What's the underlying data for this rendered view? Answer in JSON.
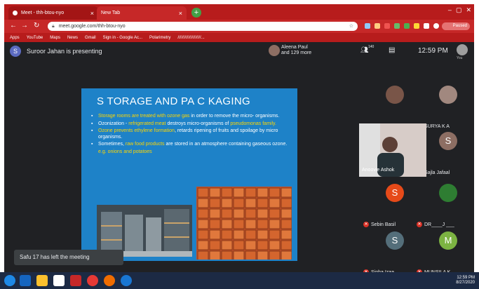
{
  "browser": {
    "tabs": [
      {
        "label": "Meet - thh-btou-nyo",
        "close": "×"
      },
      {
        "label": "New Tab",
        "close": "×"
      }
    ],
    "new_tab": "+",
    "window_controls": [
      "–",
      "▢",
      "✕"
    ],
    "url": "meet.google.com/thh-btou-nyo",
    "profile": "Paused",
    "bookmarks": [
      "Apps",
      "YouTube",
      "Maps",
      "News",
      "Gmail",
      "Sign in - Google Ac...",
      "Polarimetry",
      "////////////////////..."
    ]
  },
  "meet": {
    "presenter_initial": "S",
    "presenter_text": "Suroor Jahan is presenting",
    "people_line1": "Aleena Paul",
    "people_line2": "and 129 more",
    "participant_count": "140",
    "time": "12:59 PM",
    "you_label": "You",
    "toast": "Safu 17 has left the meeting"
  },
  "slide": {
    "title": "S TORAGE AND PA C KAGING",
    "bullets": [
      {
        "parts": [
          [
            "Storage rooms are treated with ",
            "y"
          ],
          [
            "ozone gas",
            "y"
          ],
          [
            " in order to remove the micro- organisms.",
            ""
          ]
        ]
      },
      {
        "parts": [
          [
            "Ozonization - ",
            ""
          ],
          [
            "refrigerated meat",
            "y"
          ],
          [
            " destroys micro-organisms of ",
            ""
          ],
          [
            "pseudomonas family.",
            "y"
          ]
        ]
      },
      {
        "parts": [
          [
            "Ozone prevents ethylene formation",
            "y"
          ],
          [
            ", retards ripening of fruits and spoilage by micro organisms.",
            ""
          ]
        ]
      },
      {
        "parts": [
          [
            "Sometimes, ",
            ""
          ],
          [
            "raw food products",
            "y"
          ],
          [
            " are stored in an atmosphere containing gaseous ozone.",
            ""
          ]
        ]
      }
    ],
    "example": "e.g. onions and potatoes"
  },
  "participants": [
    {
      "name": "Muhaimin Fister",
      "initial": "",
      "color": "#795548"
    },
    {
      "name": "SURYA K A",
      "initial": "",
      "color": "#a1887f"
    },
    {
      "name": "Sajla Jafaal",
      "initial": "S",
      "color": "#8d6e63"
    },
    {
      "name": "Sebin Basil",
      "initial": "S",
      "color": "#e64a19"
    },
    {
      "name": "DR____J ___",
      "initial": "",
      "color": "#2e7d32"
    },
    {
      "name": "Sinha Izaa",
      "initial": "S",
      "color": "#546e7a"
    },
    {
      "name": "MUNSILA K",
      "initial": "M",
      "color": "#7cb342"
    }
  ],
  "active_speaker": "Anoovie Ashok",
  "taskbar": {
    "time": "12:59 PM",
    "date": "8/27/2020"
  }
}
